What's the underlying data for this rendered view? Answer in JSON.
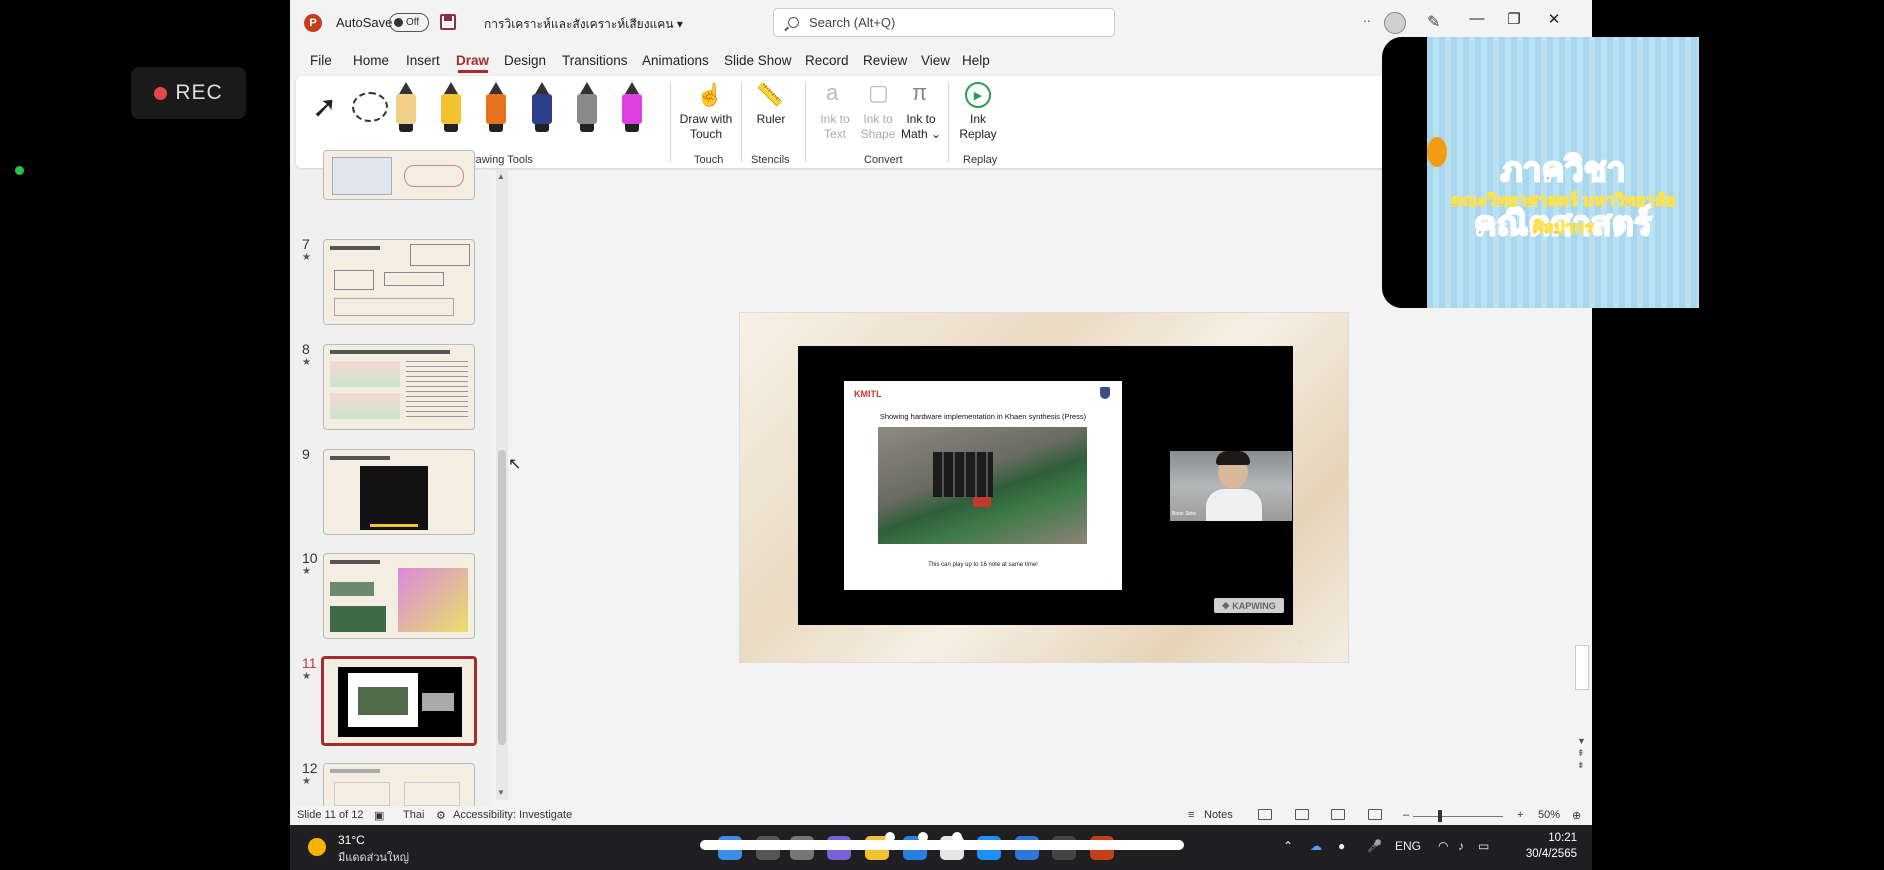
{
  "recording": {
    "label": "REC"
  },
  "titlebar": {
    "autosave_label": "AutoSave",
    "autosave_state": "Off",
    "document_title": "การวิเคราะห์และสังเคราะห์เสียงแคน",
    "search_placeholder": "Search (Alt+Q)",
    "more_indicator": ".."
  },
  "menu": {
    "items": [
      "File",
      "Home",
      "Insert",
      "Draw",
      "Design",
      "Transitions",
      "Animations",
      "Slide Show",
      "Record",
      "Review",
      "View",
      "Help"
    ],
    "active": "Draw"
  },
  "ribbon": {
    "groups": {
      "drawing_tools": "Drawing Tools",
      "touch": "Touch",
      "stencils": "Stencils",
      "convert": "Convert",
      "replay": "Replay"
    },
    "buttons": {
      "draw_with_touch_1": "Draw with",
      "draw_with_touch_2": "Touch",
      "ruler": "Ruler",
      "ink_to_text_1": "Ink to",
      "ink_to_text_2": "Text",
      "ink_to_shape_1": "Ink to",
      "ink_to_shape_2": "Shape",
      "ink_to_math_1": "Ink to",
      "ink_to_math_2": "Math ⌄",
      "ink_replay_1": "Ink",
      "ink_replay_2": "Replay"
    },
    "pen_colors": [
      "#f2d08a",
      "#f2c230",
      "#e8731e",
      "#2d3e8c",
      "#8a8a8a",
      "#e040e0"
    ]
  },
  "thumbnails": [
    {
      "number": "7",
      "star": "★"
    },
    {
      "number": "8",
      "star": "★"
    },
    {
      "number": "9",
      "star": ""
    },
    {
      "number": "10",
      "star": "★"
    },
    {
      "number": "11",
      "star": "★"
    },
    {
      "number": "12",
      "star": "★"
    }
  ],
  "slide": {
    "brand": "KMITL",
    "title": "Showing hardware implementation in Khaen synthesis (Press)",
    "caption": "This can play up to 16 note at same time!",
    "watermark": "KAPWING",
    "webcam_name": "Boon Siriw"
  },
  "statusbar": {
    "slide_counter": "Slide 11 of 12",
    "language": "Thai",
    "accessibility": "Accessibility: Investigate",
    "notes": "Notes",
    "zoom": "50%"
  },
  "overlay": {
    "line1": "ภาควิชาคณิตศาสตร์",
    "line2": "คณะวิทยาศาสตร์ มหาวิทยาลัยศิลปากร"
  },
  "taskbar": {
    "temperature": "31°C",
    "weather": "มีแดดส่วนใหญ่",
    "language": "ENG",
    "time": "10:21",
    "date": "30/4/2565"
  }
}
